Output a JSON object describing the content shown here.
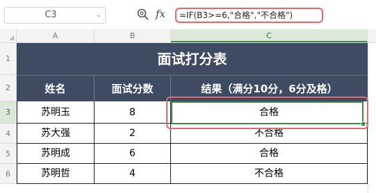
{
  "formula_bar": {
    "name_box": "C3",
    "name_box_arrow": "⌄",
    "fx_label": "fx",
    "formula": "=IF(B3>=6,\"合格\",\"不合格\")"
  },
  "columns": [
    "A",
    "B",
    "C"
  ],
  "rows": [
    "1",
    "2",
    "3",
    "4",
    "5",
    "6"
  ],
  "table": {
    "title": "面试打分表",
    "headers": [
      "姓名",
      "面试分数",
      "结果（满分10分，6分及格）"
    ],
    "data": [
      [
        "苏明玉",
        "8",
        "合格"
      ],
      [
        "苏大强",
        "2",
        "不合格"
      ],
      [
        "苏明成",
        "6",
        "合格"
      ],
      [
        "苏明哲",
        "4",
        "不合格"
      ]
    ]
  },
  "colors": {
    "header_fill": "#3e4b63",
    "highlight_red": "#e06a6a",
    "selection_green": "#3f8a4f"
  }
}
